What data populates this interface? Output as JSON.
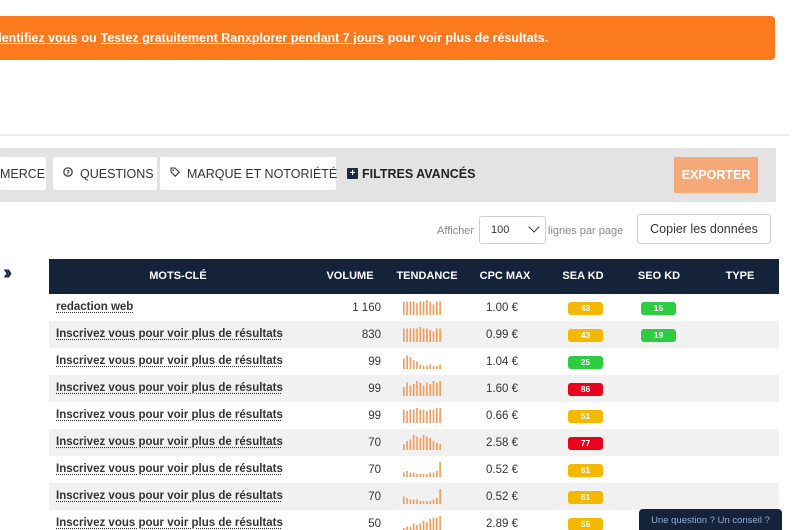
{
  "banner": {
    "link1": "dentifiez vous",
    "middle": "ou",
    "link2": "Testez gratuitement Ranxplorer pendant 7 jours",
    "rest": "pour voir plus de résultats."
  },
  "filters": {
    "tab_commerce": "MERCE",
    "tab_questions": "QUESTIONS",
    "tab_brand": "MARQUE ET NOTORIÉTÉ",
    "advanced": "FILTRES AVANCÉS",
    "export": "EXPORTER"
  },
  "pager": {
    "show_label": "Afficher",
    "page_size": "100",
    "lines_label": "lignes par page",
    "copy_button": "Copier les données"
  },
  "table": {
    "headers": {
      "keyword": "MOTS-CLÉ",
      "volume": "VOLUME",
      "trend": "TENDANCE",
      "cpc": "CPC MAX",
      "sea": "SEA KD",
      "seo": "SEO KD",
      "type": "TYPE"
    },
    "rows": [
      {
        "keyword": "redaction web",
        "volume": "1 160",
        "cpc": "1.00 €",
        "sea": "43",
        "sea_color": "#f5b800",
        "seo": "15",
        "seo_color": "#2ecc40",
        "trend": [
          9,
          9,
          9,
          9,
          8,
          9,
          9,
          10,
          9,
          7,
          9,
          9
        ]
      },
      {
        "keyword": "Inscrivez vous pour voir plus de résultats",
        "volume": "830",
        "cpc": "0.99 €",
        "sea": "43",
        "sea_color": "#f5b800",
        "seo": "19",
        "seo_color": "#2ecc40",
        "trend": [
          9,
          9,
          9,
          9,
          9,
          10,
          9,
          9,
          8,
          7,
          9,
          9
        ]
      },
      {
        "keyword": "Inscrivez vous pour voir plus de résultats",
        "volume": "99",
        "cpc": "1.04 €",
        "sea": "25",
        "sea_color": "#2ecc40",
        "seo": "",
        "seo_color": "",
        "trend": [
          7,
          9,
          8,
          6,
          5,
          3,
          2,
          2,
          3,
          2,
          2,
          3
        ]
      },
      {
        "keyword": "Inscrivez vous pour voir plus de résultats",
        "volume": "99",
        "cpc": "1.60 €",
        "sea": "86",
        "sea_color": "#e8001c",
        "seo": "",
        "seo_color": "",
        "trend": [
          6,
          9,
          7,
          8,
          10,
          9,
          7,
          9,
          8,
          10,
          9,
          10
        ]
      },
      {
        "keyword": "Inscrivez vous pour voir plus de résultats",
        "volume": "99",
        "cpc": "0.66 €",
        "sea": "51",
        "sea_color": "#f5b800",
        "seo": "",
        "seo_color": "",
        "trend": [
          9,
          8,
          9,
          9,
          10,
          9,
          9,
          8,
          9,
          9,
          10,
          10
        ]
      },
      {
        "keyword": "Inscrivez vous pour voir plus de résultats",
        "volume": "70",
        "cpc": "2.58 €",
        "sea": "77",
        "sea_color": "#e8001c",
        "seo": "",
        "seo_color": "",
        "trend": [
          4,
          6,
          7,
          10,
          9,
          8,
          10,
          9,
          8,
          6,
          5,
          4
        ]
      },
      {
        "keyword": "Inscrivez vous pour voir plus de résultats",
        "volume": "70",
        "cpc": "0.52 €",
        "sea": "61",
        "sea_color": "#f5b800",
        "seo": "",
        "seo_color": "",
        "trend": [
          3,
          4,
          3,
          3,
          2,
          2,
          2,
          2,
          3,
          3,
          4,
          10
        ]
      },
      {
        "keyword": "Inscrivez vous pour voir plus de résultats",
        "volume": "70",
        "cpc": "0.52 €",
        "sea": "61",
        "sea_color": "#f5b800",
        "seo": "",
        "seo_color": "",
        "trend": [
          5,
          4,
          3,
          3,
          3,
          2,
          2,
          2,
          2,
          3,
          4,
          10
        ]
      },
      {
        "keyword": "Inscrivez vous pour voir plus de résultats",
        "volume": "50",
        "cpc": "2.89 €",
        "sea": "55",
        "sea_color": "#f5b800",
        "seo": "",
        "seo_color": "",
        "trend": [
          2,
          3,
          3,
          5,
          4,
          5,
          7,
          6,
          8,
          9,
          9,
          10
        ]
      }
    ]
  },
  "chat": "Une question ? Un conseil ?",
  "colors": {
    "banner": "#fb7a1d",
    "header": "#14223a",
    "trend_bar": "#f39a55",
    "export": "#f6a878"
  }
}
